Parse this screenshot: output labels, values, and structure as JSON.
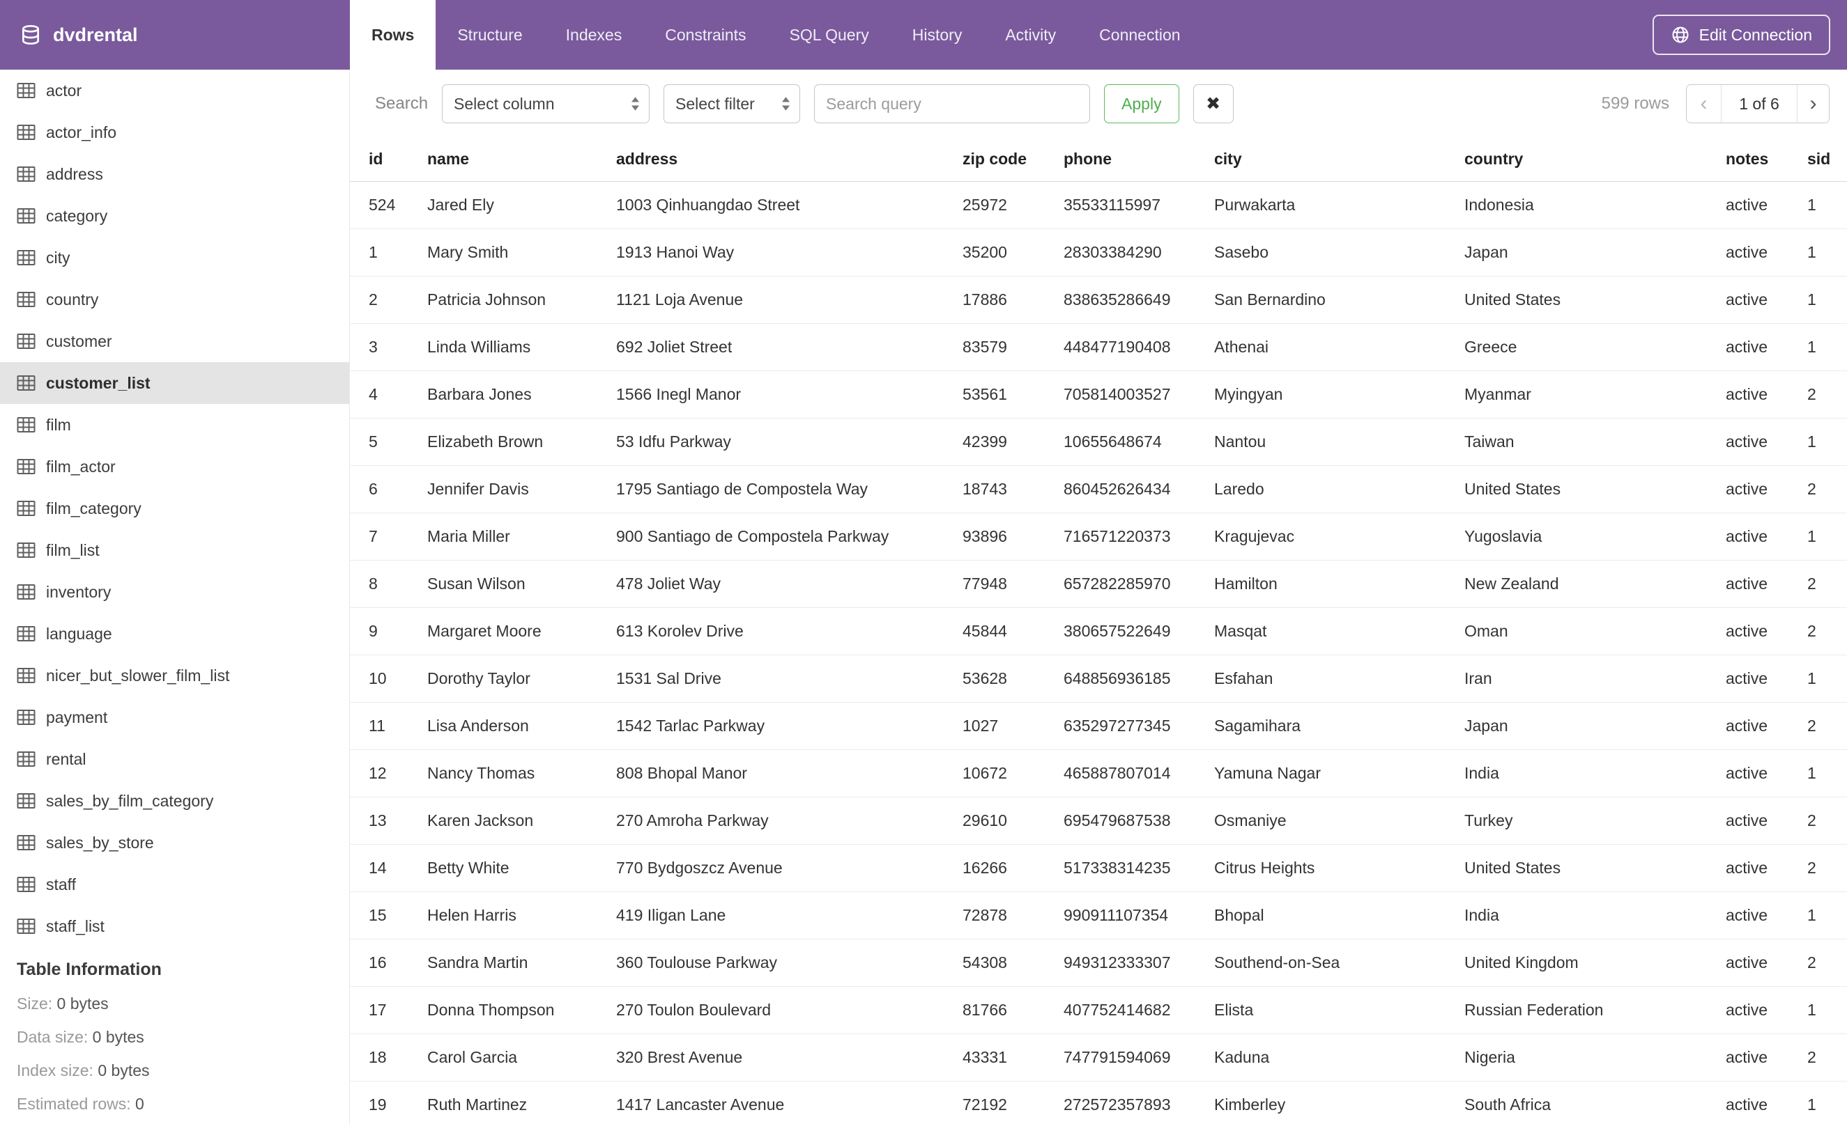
{
  "header": {
    "app_title": "dvdrental",
    "tabs": [
      {
        "label": "Rows",
        "active": true
      },
      {
        "label": "Structure",
        "active": false
      },
      {
        "label": "Indexes",
        "active": false
      },
      {
        "label": "Constraints",
        "active": false
      },
      {
        "label": "SQL Query",
        "active": false
      },
      {
        "label": "History",
        "active": false
      },
      {
        "label": "Activity",
        "active": false
      },
      {
        "label": "Connection",
        "active": false
      }
    ],
    "edit_connection_label": "Edit Connection"
  },
  "sidebar": {
    "tables": [
      "actor",
      "actor_info",
      "address",
      "category",
      "city",
      "country",
      "customer",
      "customer_list",
      "film",
      "film_actor",
      "film_category",
      "film_list",
      "inventory",
      "language",
      "nicer_but_slower_film_list",
      "payment",
      "rental",
      "sales_by_film_category",
      "sales_by_store",
      "staff",
      "staff_list"
    ],
    "selected_table": "customer_list",
    "table_information": {
      "heading": "Table Information",
      "items": [
        {
          "label": "Size:",
          "value": "0 bytes"
        },
        {
          "label": "Data size:",
          "value": "0 bytes"
        },
        {
          "label": "Index size:",
          "value": "0 bytes"
        },
        {
          "label": "Estimated rows:",
          "value": "0"
        }
      ]
    }
  },
  "toolbar": {
    "search_label": "Search",
    "column_select_value": "Select column",
    "filter_select_value": "Select filter",
    "query_placeholder": "Search query",
    "query_value": "",
    "apply_label": "Apply",
    "clear_glyph": "✖",
    "row_count": "599 rows",
    "pagination": {
      "prev_glyph": "‹",
      "page_label": "1 of 6",
      "next_glyph": "›"
    }
  },
  "table": {
    "columns": [
      "id",
      "name",
      "address",
      "zip code",
      "phone",
      "city",
      "country",
      "notes",
      "sid"
    ],
    "rows": [
      [
        "524",
        "Jared Ely",
        "1003 Qinhuangdao Street",
        "25972",
        "35533115997",
        "Purwakarta",
        "Indonesia",
        "active",
        "1"
      ],
      [
        "1",
        "Mary Smith",
        "1913 Hanoi Way",
        "35200",
        "28303384290",
        "Sasebo",
        "Japan",
        "active",
        "1"
      ],
      [
        "2",
        "Patricia Johnson",
        "1121 Loja Avenue",
        "17886",
        "838635286649",
        "San Bernardino",
        "United States",
        "active",
        "1"
      ],
      [
        "3",
        "Linda Williams",
        "692 Joliet Street",
        "83579",
        "448477190408",
        "Athenai",
        "Greece",
        "active",
        "1"
      ],
      [
        "4",
        "Barbara Jones",
        "1566 Inegl Manor",
        "53561",
        "705814003527",
        "Myingyan",
        "Myanmar",
        "active",
        "2"
      ],
      [
        "5",
        "Elizabeth Brown",
        "53 Idfu Parkway",
        "42399",
        "10655648674",
        "Nantou",
        "Taiwan",
        "active",
        "1"
      ],
      [
        "6",
        "Jennifer Davis",
        "1795 Santiago de Compostela Way",
        "18743",
        "860452626434",
        "Laredo",
        "United States",
        "active",
        "2"
      ],
      [
        "7",
        "Maria Miller",
        "900 Santiago de Compostela Parkway",
        "93896",
        "716571220373",
        "Kragujevac",
        "Yugoslavia",
        "active",
        "1"
      ],
      [
        "8",
        "Susan Wilson",
        "478 Joliet Way",
        "77948",
        "657282285970",
        "Hamilton",
        "New Zealand",
        "active",
        "2"
      ],
      [
        "9",
        "Margaret Moore",
        "613 Korolev Drive",
        "45844",
        "380657522649",
        "Masqat",
        "Oman",
        "active",
        "2"
      ],
      [
        "10",
        "Dorothy Taylor",
        "1531 Sal Drive",
        "53628",
        "648856936185",
        "Esfahan",
        "Iran",
        "active",
        "1"
      ],
      [
        "11",
        "Lisa Anderson",
        "1542 Tarlac Parkway",
        "1027",
        "635297277345",
        "Sagamihara",
        "Japan",
        "active",
        "2"
      ],
      [
        "12",
        "Nancy Thomas",
        "808 Bhopal Manor",
        "10672",
        "465887807014",
        "Yamuna Nagar",
        "India",
        "active",
        "1"
      ],
      [
        "13",
        "Karen Jackson",
        "270 Amroha Parkway",
        "29610",
        "695479687538",
        "Osmaniye",
        "Turkey",
        "active",
        "2"
      ],
      [
        "14",
        "Betty White",
        "770 Bydgoszcz Avenue",
        "16266",
        "517338314235",
        "Citrus Heights",
        "United States",
        "active",
        "2"
      ],
      [
        "15",
        "Helen Harris",
        "419 Iligan Lane",
        "72878",
        "990911107354",
        "Bhopal",
        "India",
        "active",
        "1"
      ],
      [
        "16",
        "Sandra Martin",
        "360 Toulouse Parkway",
        "54308",
        "949312333307",
        "Southend-on-Sea",
        "United Kingdom",
        "active",
        "2"
      ],
      [
        "17",
        "Donna Thompson",
        "270 Toulon Boulevard",
        "81766",
        "407752414682",
        "Elista",
        "Russian Federation",
        "active",
        "1"
      ],
      [
        "18",
        "Carol Garcia",
        "320 Brest Avenue",
        "43331",
        "747791594069",
        "Kaduna",
        "Nigeria",
        "active",
        "2"
      ],
      [
        "19",
        "Ruth Martinez",
        "1417 Lancaster Avenue",
        "72192",
        "272572357893",
        "Kimberley",
        "South Africa",
        "active",
        "1"
      ]
    ]
  },
  "colors": {
    "header_purple": "#7a5a9c",
    "apply_green": "#5cb85c",
    "selected_item_bg": "#e4e4e4"
  }
}
